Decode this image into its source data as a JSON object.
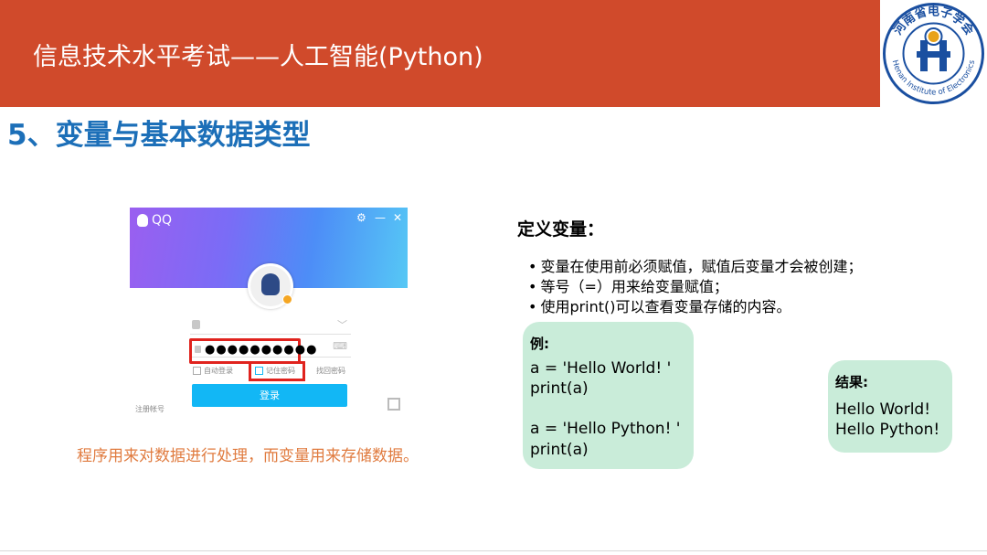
{
  "header": {
    "title": "信息技术水平考试——人工智能(Python)",
    "logo": {
      "text_top": "河南省电子学会",
      "text_bottom": "Henan Institute of Electronics",
      "color": "#1a4fa0"
    }
  },
  "section_title": "5、变量与基本数据类型",
  "qq_login": {
    "app_name": "QQ",
    "password_mask": "●●●●●●●●●●",
    "auto_login": "自动登录",
    "remember_password": "记住密码",
    "retrieve_password": "找回密码",
    "login_button": "登录",
    "register_account": "注册帐号"
  },
  "caption": "程序用来对数据进行处理，而变量用来存储数据。",
  "definition": {
    "title": "定义变量：",
    "bullets": [
      "变量在使用前必须赋值，赋值后变量才会被创建；",
      "等号（=）用来给变量赋值；",
      "使用print()可以查看变量存储的内容。"
    ]
  },
  "example": {
    "label": "例:",
    "code": [
      "a = 'Hello World! '",
      "print(a)",
      "a = 'Hello Python! '",
      "print(a)"
    ]
  },
  "result": {
    "label": "结果:",
    "lines": [
      "Hello World!",
      "Hello Python!"
    ]
  },
  "colors": {
    "header_bg": "#d04a2b",
    "section_title": "#1c6fb8",
    "caption": "#e07b3f",
    "box_bg": "#c9ecd9",
    "highlight": "#e0231e"
  }
}
